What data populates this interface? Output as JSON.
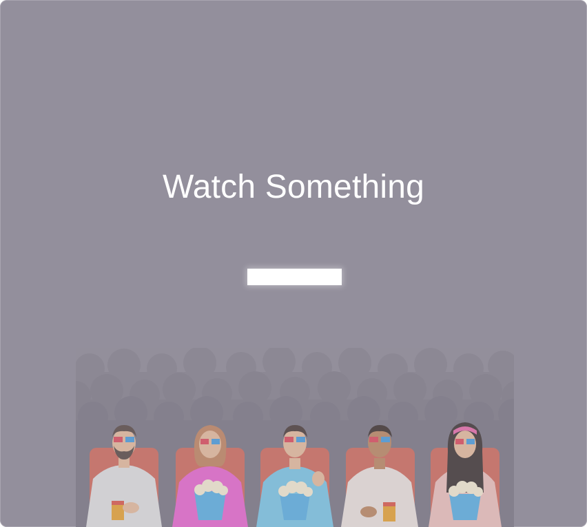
{
  "title": "Watch Something",
  "cta": {
    "label": ""
  },
  "colors": {
    "background": "#938f9c",
    "title": "#ffffff",
    "button": "#ffffff",
    "seat": "#e26d5a"
  },
  "illustration": {
    "name": "cinema-audience",
    "viewers": [
      {
        "name": "viewer-bearded-man",
        "shirt": "#e9e9e9",
        "holds": "drink"
      },
      {
        "name": "viewer-woman-pink",
        "shirt": "#f26ad7",
        "holds": "popcorn"
      },
      {
        "name": "viewer-man-blue",
        "shirt": "#7fcff0",
        "holds": "popcorn"
      },
      {
        "name": "viewer-man-white",
        "shirt": "#f6ece6",
        "holds": "drink"
      },
      {
        "name": "viewer-woman-long-hair",
        "shirt": "#f7c9c4",
        "holds": "popcorn"
      }
    ]
  }
}
